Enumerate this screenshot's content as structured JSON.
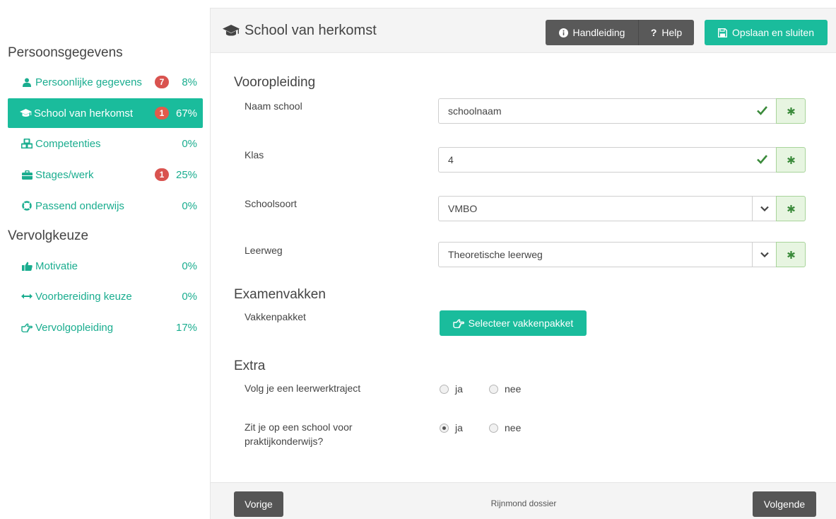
{
  "sidebar": {
    "section1_title": "Persoonsgegevens",
    "section2_title": "Vervolgkeuze",
    "items": [
      {
        "label": "Persoonlijke gegevens",
        "badge": "7",
        "pct": "8%",
        "icon": "user-icon"
      },
      {
        "label": "School van herkomst",
        "badge": "1",
        "pct": "67%",
        "icon": "graduation-cap-icon",
        "active": true
      },
      {
        "label": "Competenties",
        "badge": "",
        "pct": "0%",
        "icon": "cubes-icon"
      },
      {
        "label": "Stages/werk",
        "badge": "1",
        "pct": "25%",
        "icon": "briefcase-icon"
      },
      {
        "label": "Passend onderwijs",
        "badge": "",
        "pct": "0%",
        "icon": "lifebuoy-icon"
      },
      {
        "label": "Motivatie",
        "badge": "",
        "pct": "0%",
        "icon": "thumbs-up-icon"
      },
      {
        "label": "Voorbereiding keuze",
        "badge": "",
        "pct": "0%",
        "icon": "arrows-horizontal-icon"
      },
      {
        "label": "Vervolgopleiding",
        "badge": "",
        "pct": "17%",
        "icon": "hand-pointer-icon"
      }
    ]
  },
  "header": {
    "title": "School van herkomst",
    "handleiding_label": "Handleiding",
    "help_label": "Help",
    "save_label": "Opslaan en sluiten"
  },
  "form": {
    "section_vooropleiding": "Vooropleiding",
    "naam_school": {
      "label": "Naam school",
      "value": "schoolnaam"
    },
    "klas": {
      "label": "Klas",
      "value": "4"
    },
    "schoolsoort": {
      "label": "Schoolsoort",
      "value": "VMBO"
    },
    "leerweg": {
      "label": "Leerweg",
      "value": "Theoretische leerweg"
    },
    "section_examenvakken": "Examenvakken",
    "vakkenpakket": {
      "label": "Vakkenpakket",
      "button": "Selecteer vakkenpakket"
    },
    "section_extra": "Extra",
    "leerwerktraject": {
      "label": "Volg je een leerwerktraject",
      "yes": "ja",
      "no": "nee",
      "selected": "none"
    },
    "praktijkonderwijs": {
      "label_line1": "Zit je op een school voor",
      "label_line2": "praktijkonderwijs?",
      "yes": "ja",
      "no": "nee",
      "selected": "ja"
    }
  },
  "footer": {
    "prev_label": "Vorige",
    "center_text": "Rijnmond dossier",
    "next_label": "Volgende"
  },
  "colors": {
    "accent": "#1abc9c",
    "badge": "#d9534f",
    "dark_button": "#595959"
  }
}
